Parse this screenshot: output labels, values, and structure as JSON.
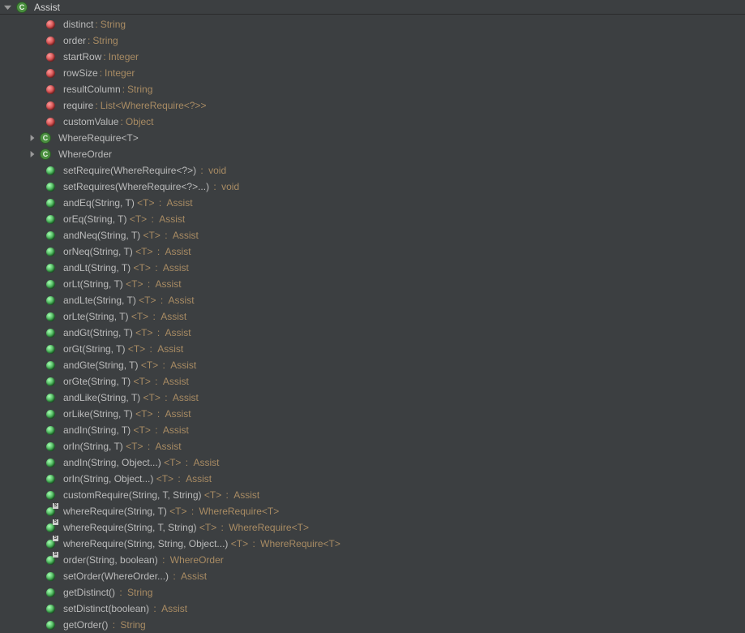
{
  "header": {
    "title": "Assist"
  },
  "tree": {
    "fields": [
      {
        "name": "distinct",
        "type": "String"
      },
      {
        "name": "order",
        "type": "String"
      },
      {
        "name": "startRow",
        "type": "Integer"
      },
      {
        "name": "rowSize",
        "type": "Integer"
      },
      {
        "name": "resultColumn",
        "type": "String"
      },
      {
        "name": "require",
        "type": "List<WhereRequire<?>>"
      },
      {
        "name": "customValue",
        "type": "Object"
      }
    ],
    "innerClasses": [
      {
        "name": "WhereRequire<T>"
      },
      {
        "name": "WhereOrder"
      }
    ],
    "methods": [
      {
        "name": "setRequire(WhereRequire<?>)",
        "generic": "",
        "ret": "void",
        "static": false
      },
      {
        "name": "setRequires(WhereRequire<?>...)",
        "generic": "",
        "ret": "void",
        "static": false
      },
      {
        "name": "andEq(String, T)",
        "generic": "<T>",
        "ret": "Assist",
        "static": false
      },
      {
        "name": "orEq(String, T)",
        "generic": "<T>",
        "ret": "Assist",
        "static": false
      },
      {
        "name": "andNeq(String, T)",
        "generic": "<T>",
        "ret": "Assist",
        "static": false
      },
      {
        "name": "orNeq(String, T)",
        "generic": "<T>",
        "ret": "Assist",
        "static": false
      },
      {
        "name": "andLt(String, T)",
        "generic": "<T>",
        "ret": "Assist",
        "static": false
      },
      {
        "name": "orLt(String, T)",
        "generic": "<T>",
        "ret": "Assist",
        "static": false
      },
      {
        "name": "andLte(String, T)",
        "generic": "<T>",
        "ret": "Assist",
        "static": false
      },
      {
        "name": "orLte(String, T)",
        "generic": "<T>",
        "ret": "Assist",
        "static": false
      },
      {
        "name": "andGt(String, T)",
        "generic": "<T>",
        "ret": "Assist",
        "static": false
      },
      {
        "name": "orGt(String, T)",
        "generic": "<T>",
        "ret": "Assist",
        "static": false
      },
      {
        "name": "andGte(String, T)",
        "generic": "<T>",
        "ret": "Assist",
        "static": false
      },
      {
        "name": "orGte(String, T)",
        "generic": "<T>",
        "ret": "Assist",
        "static": false
      },
      {
        "name": "andLike(String, T)",
        "generic": "<T>",
        "ret": "Assist",
        "static": false
      },
      {
        "name": "orLike(String, T)",
        "generic": "<T>",
        "ret": "Assist",
        "static": false
      },
      {
        "name": "andIn(String, T)",
        "generic": "<T>",
        "ret": "Assist",
        "static": false
      },
      {
        "name": "orIn(String, T)",
        "generic": "<T>",
        "ret": "Assist",
        "static": false
      },
      {
        "name": "andIn(String, Object...)",
        "generic": "<T>",
        "ret": "Assist",
        "static": false
      },
      {
        "name": "orIn(String, Object...)",
        "generic": "<T>",
        "ret": "Assist",
        "static": false
      },
      {
        "name": "customRequire(String, T, String)",
        "generic": "<T>",
        "ret": "Assist",
        "static": false
      },
      {
        "name": "whereRequire(String, T)",
        "generic": "<T>",
        "ret": "WhereRequire<T>",
        "static": true
      },
      {
        "name": "whereRequire(String, T, String)",
        "generic": "<T>",
        "ret": "WhereRequire<T>",
        "static": true
      },
      {
        "name": "whereRequire(String, String, Object...)",
        "generic": "<T>",
        "ret": "WhereRequire<T>",
        "static": true
      },
      {
        "name": "order(String, boolean)",
        "generic": "",
        "ret": "WhereOrder",
        "static": true
      },
      {
        "name": "setOrder(WhereOrder...)",
        "generic": "",
        "ret": "Assist",
        "static": false
      },
      {
        "name": "getDistinct()",
        "generic": "",
        "ret": "String",
        "static": false
      },
      {
        "name": "setDistinct(boolean)",
        "generic": "",
        "ret": "Assist",
        "static": false
      },
      {
        "name": "getOrder()",
        "generic": "",
        "ret": "String",
        "static": false
      }
    ]
  }
}
